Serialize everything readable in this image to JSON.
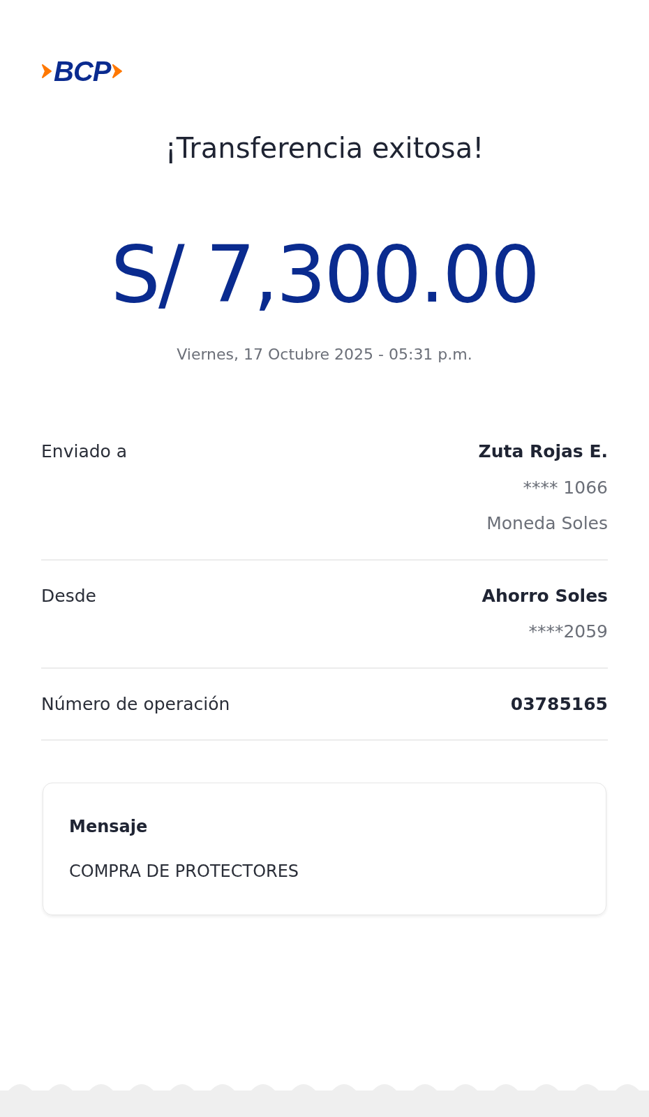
{
  "logo": "BCP",
  "title": "¡Transferencia exitosa!",
  "amount": "S/ 7,300.00",
  "datetime": "Viernes, 17 Octubre 2025 - 05:31 p.m.",
  "details": [
    {
      "label": "Enviado a",
      "values": [
        {
          "text": "Zuta Rojas E.",
          "bold": true
        },
        {
          "text": "**** 1066",
          "bold": false
        },
        {
          "text": "Moneda Soles",
          "bold": false
        }
      ]
    },
    {
      "label": "Desde",
      "values": [
        {
          "text": "Ahorro Soles",
          "bold": true
        },
        {
          "text": "****2059",
          "bold": false
        }
      ]
    },
    {
      "label": "Número de operación",
      "values": [
        {
          "text": "03785165",
          "bold": true
        }
      ]
    }
  ],
  "message": {
    "label": "Mensaje",
    "text": "COMPRA DE PROTECTORES"
  }
}
